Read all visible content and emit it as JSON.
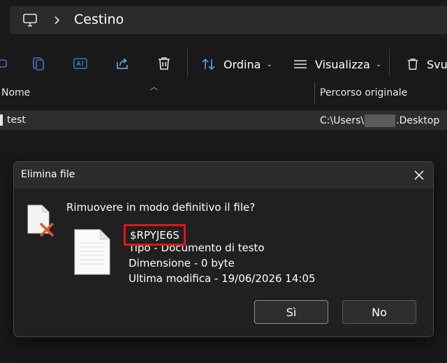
{
  "address_bar": {
    "icon": "computer-monitor-icon",
    "separator_icon": "chevron-right-icon",
    "location": "Cestino"
  },
  "toolbar": {
    "icons": [
      "drive-icon",
      "paste-icon",
      "rename-icon",
      "share-icon",
      "delete-icon"
    ],
    "sort_label": "Ordina",
    "view_label": "Visualizza",
    "empty_label": "Svuo"
  },
  "file_list": {
    "columns": [
      "Nome",
      "Percorso originale"
    ],
    "rows": [
      {
        "name": "test",
        "path_prefix": "C:\\Users\\",
        "path_suffix": ".Desktop"
      }
    ]
  },
  "dialog": {
    "title": "Elimina file",
    "question": "Rimuovere in modo definitivo il file?",
    "file_name": "$RPYJE6S",
    "type_line": "Tipo - Documento di testo",
    "size_line": "Dimensione - 0 byte",
    "modified_line": "Ultima modifica - 19/06/2026 14:05",
    "yes_label": "Sì",
    "no_label": "No",
    "highlight_color": "#e0161b"
  }
}
